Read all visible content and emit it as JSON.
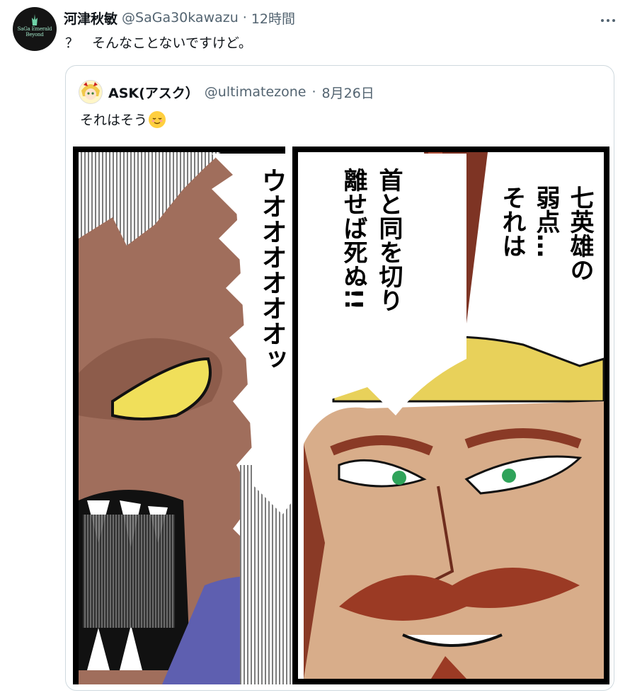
{
  "tweet": {
    "display_name": "河津秋敏",
    "handle": "@SaGa30kawazu",
    "separator": "·",
    "time": "12時間",
    "text": "？　そんなことないですけど。",
    "more_icon": "more-dots-icon",
    "avatar_logo_text": "SaGa Emerald Beyond"
  },
  "quote": {
    "display_name": "ASK(アスク）",
    "handle": "@ultimatezone",
    "separator": "·",
    "date": "8月26日",
    "text": "それはそう",
    "emoji": "relieved-face-emoji"
  },
  "comic": {
    "speech_right_1": "七英雄の",
    "speech_right_2": "弱点…",
    "speech_right_3": "それは",
    "speech_center_1": "首と同を切り",
    "speech_center_2": "離せば死ぬ!!",
    "speech_left": "ウオオオオオオッ"
  },
  "colors": {
    "border": "#cfd9de",
    "muted_text": "#536471",
    "text": "#0f1419"
  }
}
